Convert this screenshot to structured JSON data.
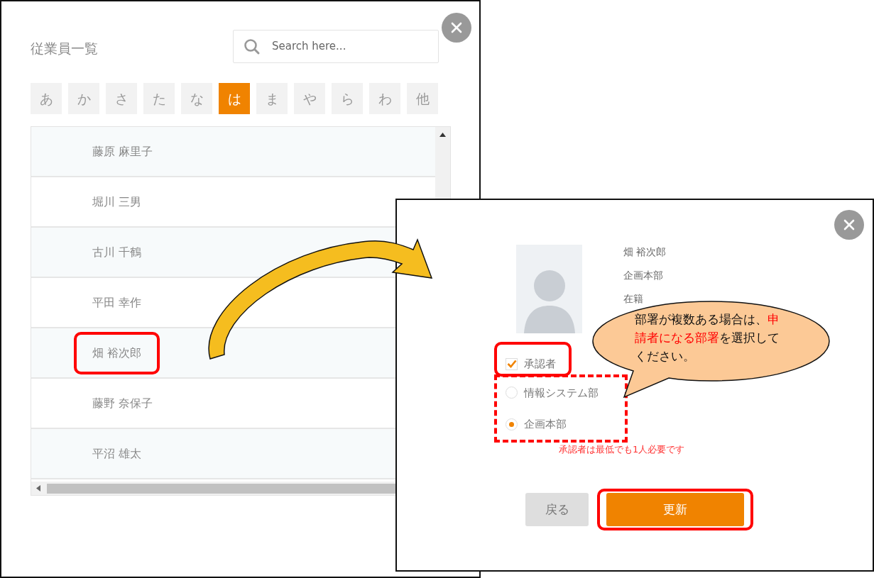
{
  "list_panel": {
    "title": "従業員一覧",
    "search": {
      "placeholder": "Search here..."
    },
    "kana_tabs": [
      {
        "label": "あ",
        "selected": false
      },
      {
        "label": "か",
        "selected": false
      },
      {
        "label": "さ",
        "selected": false
      },
      {
        "label": "た",
        "selected": false
      },
      {
        "label": "な",
        "selected": false
      },
      {
        "label": "は",
        "selected": true
      },
      {
        "label": "ま",
        "selected": false
      },
      {
        "label": "や",
        "selected": false
      },
      {
        "label": "ら",
        "selected": false
      },
      {
        "label": "わ",
        "selected": false
      },
      {
        "label": "他",
        "selected": false
      }
    ],
    "employees": [
      {
        "name": "藤原 麻里子",
        "highlighted": false
      },
      {
        "name": "堀川 三男",
        "highlighted": false
      },
      {
        "name": "古川 千鶴",
        "highlighted": false
      },
      {
        "name": "平田 幸作",
        "highlighted": false
      },
      {
        "name": "畑 裕次郎",
        "highlighted": true
      },
      {
        "name": "藤野 奈保子",
        "highlighted": false
      },
      {
        "name": "平沼 雄太",
        "highlighted": false
      }
    ]
  },
  "detail_panel": {
    "name": "畑 裕次郎",
    "department": "企画本部",
    "status": "在籍",
    "approver": {
      "label": "承認者",
      "checked": true,
      "highlighted": true
    },
    "departments_highlighted": true,
    "departments": [
      {
        "label": "情報システム部",
        "selected": false
      },
      {
        "label": "企画本部",
        "selected": true
      }
    ],
    "error": "承認者は最低でも1人必要です",
    "buttons": [
      {
        "label": "戻る",
        "kind": "secondary"
      },
      {
        "label": "更新",
        "kind": "primary",
        "highlighted": true
      }
    ]
  },
  "callout": [
    {
      "text": "部署が複数ある場合は、",
      "emphasis": false
    },
    {
      "text": "申請者になる部署",
      "emphasis": true
    },
    {
      "text": "を選択してください。",
      "emphasis": false
    }
  ]
}
